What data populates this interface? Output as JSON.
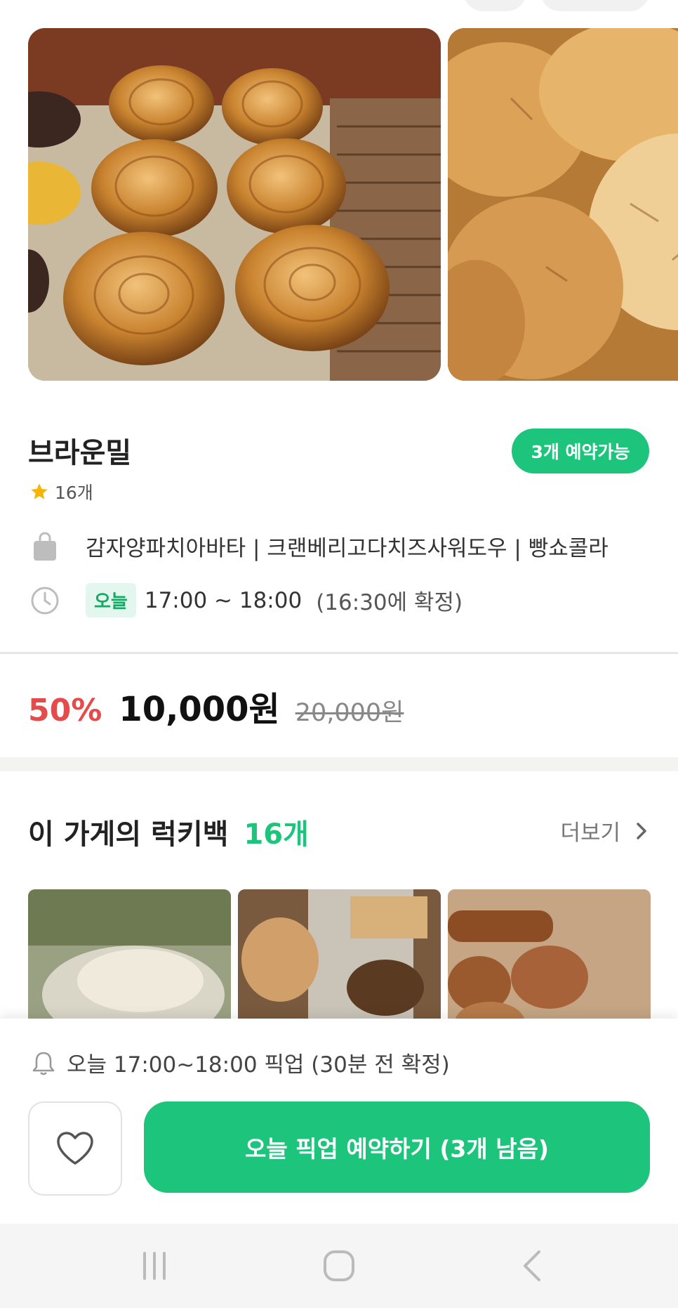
{
  "store": {
    "name": "브라운밀",
    "availability_badge": "3개 예약가능",
    "rating_count": "16개",
    "menu_items": "감자양파치아바타 | 크랜베리고다치즈사워도우 | 빵쇼콜라",
    "pickup_day": "오늘",
    "pickup_time": "17:00 ~ 18:00",
    "confirm_note": "(16:30에 확정)"
  },
  "pricing": {
    "discount": "50%",
    "price": "10,000원",
    "original_price": "20,000원"
  },
  "luckybag_section": {
    "title": "이 가게의 럭키백",
    "count": "16개",
    "more_label": "더보기"
  },
  "bottom_bar": {
    "pickup_note": "오늘 17:00~18:00 픽업 (30분 전 확정)",
    "reserve_label": "오늘 픽업 예약하기 (3개 남음)"
  },
  "colors": {
    "accent_green": "#1dc47b",
    "discount_red": "#e64b4b",
    "star_yellow": "#f7b500"
  },
  "icons": [
    "star-icon",
    "shopping-bag-icon",
    "clock-icon",
    "chevron-right-icon",
    "bell-icon",
    "heart-icon",
    "recent-apps-icon",
    "home-icon",
    "back-icon"
  ]
}
